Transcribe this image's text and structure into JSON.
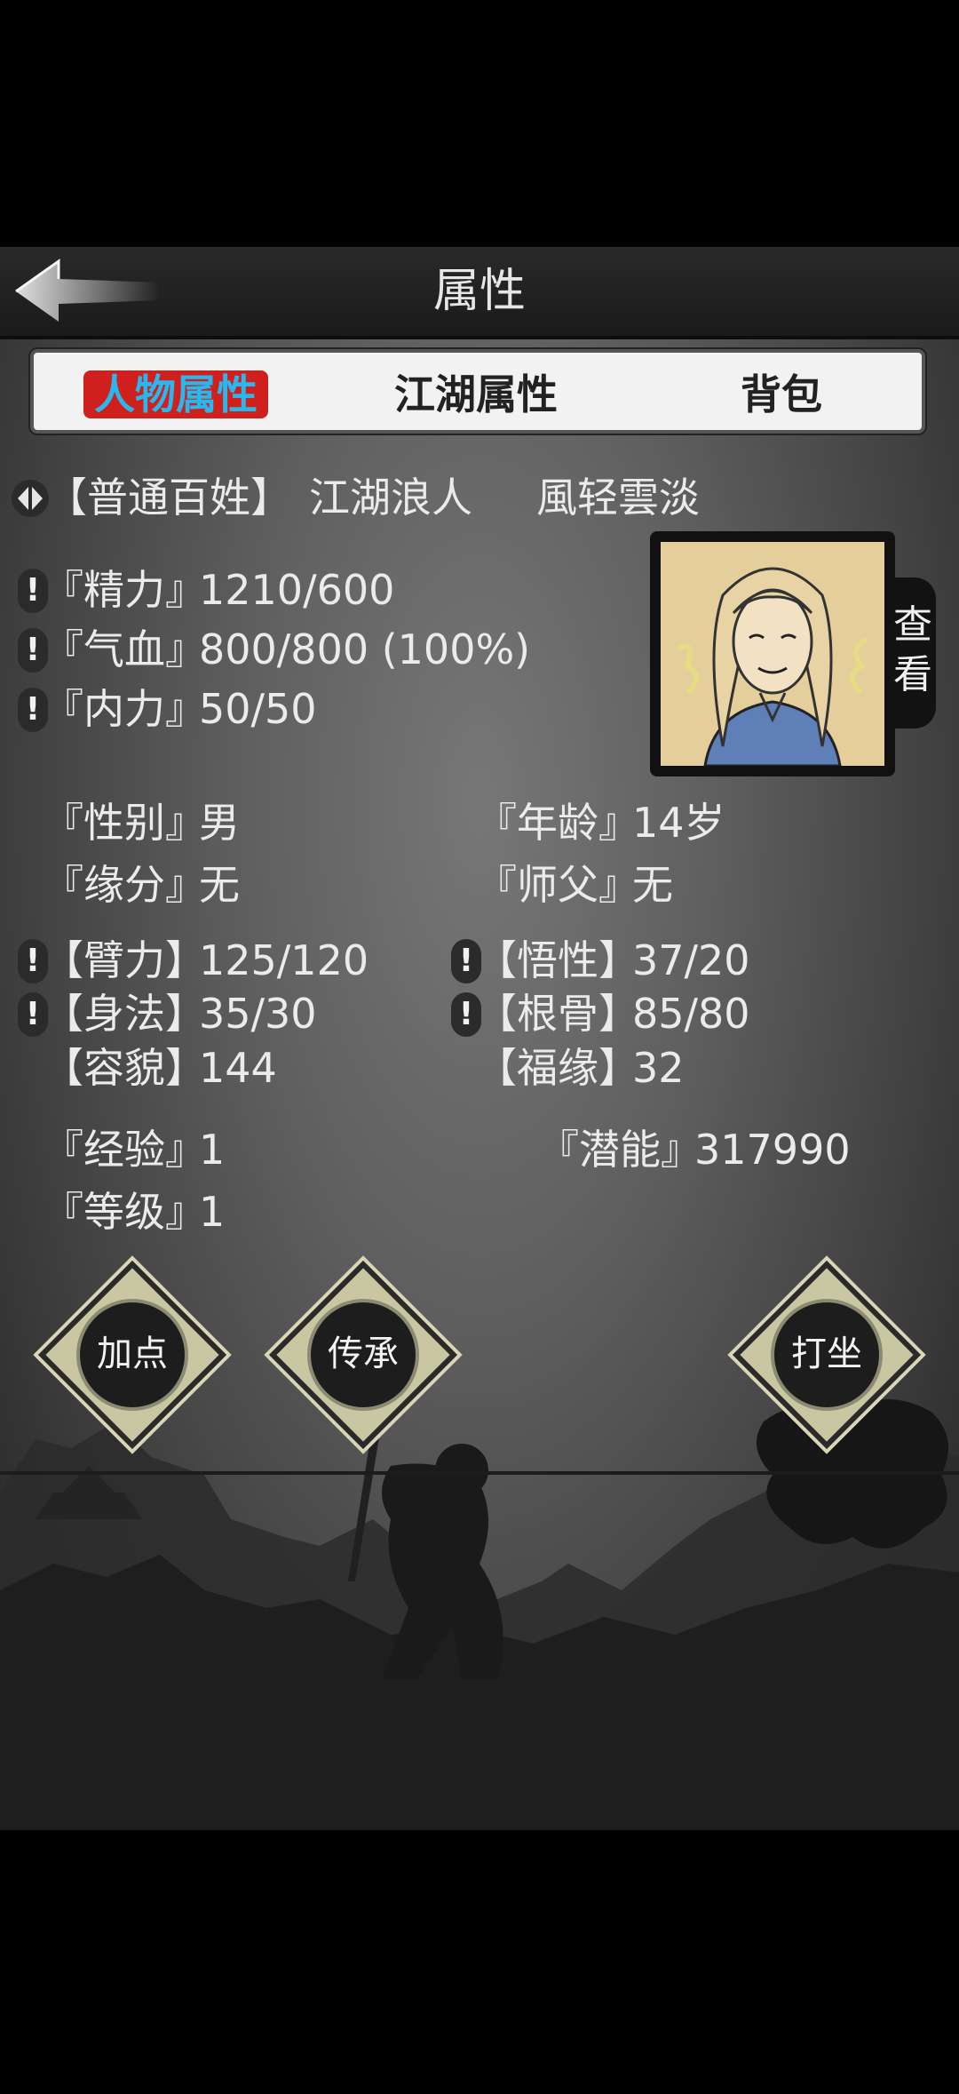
{
  "header": {
    "title": "属性",
    "back_icon": "back-arrow-icon"
  },
  "tabs": [
    {
      "label": "人物属性",
      "active": true
    },
    {
      "label": "江湖属性",
      "active": false
    },
    {
      "label": "背包",
      "active": false
    }
  ],
  "identity": {
    "rank": "【普通百姓】",
    "title": "江湖浪人",
    "name": "風轻雲淡"
  },
  "vitals": [
    {
      "label": "『精力』",
      "value": "1210/600"
    },
    {
      "label": "『气血』",
      "value": "800/800 (100%)"
    },
    {
      "label": "『内力』",
      "value": "50/50"
    }
  ],
  "portrait": {
    "view_label": "查看"
  },
  "info": {
    "gender_label": "『性别』",
    "gender": "男",
    "age_label": "『年龄』",
    "age": "14岁",
    "fate_label": "『缘分』",
    "fate": "无",
    "master_label": "『师父』",
    "master": "无"
  },
  "attributes": {
    "strength_label": "【臂力】",
    "strength": "125/120",
    "wisdom_label": "【悟性】",
    "wisdom": "37/20",
    "agility_label": "【身法】",
    "agility": "35/30",
    "constitution_label": "【根骨】",
    "constitution": "85/80",
    "looks_label": "【容貌】",
    "looks": "144",
    "luck_label": "【福缘】",
    "luck": "32"
  },
  "progress": {
    "exp_label": "『经验』",
    "exp": "1",
    "potential_label": "『潜能』",
    "potential": "317990",
    "level_label": "『等级』",
    "level": "1"
  },
  "actions": {
    "add_points": "加点",
    "inherit": "传承",
    "meditate": "打坐"
  },
  "warn_mark": "!",
  "colors": {
    "tab_active_bg": "#d0201e",
    "tab_active_text": "#27b8ee"
  }
}
